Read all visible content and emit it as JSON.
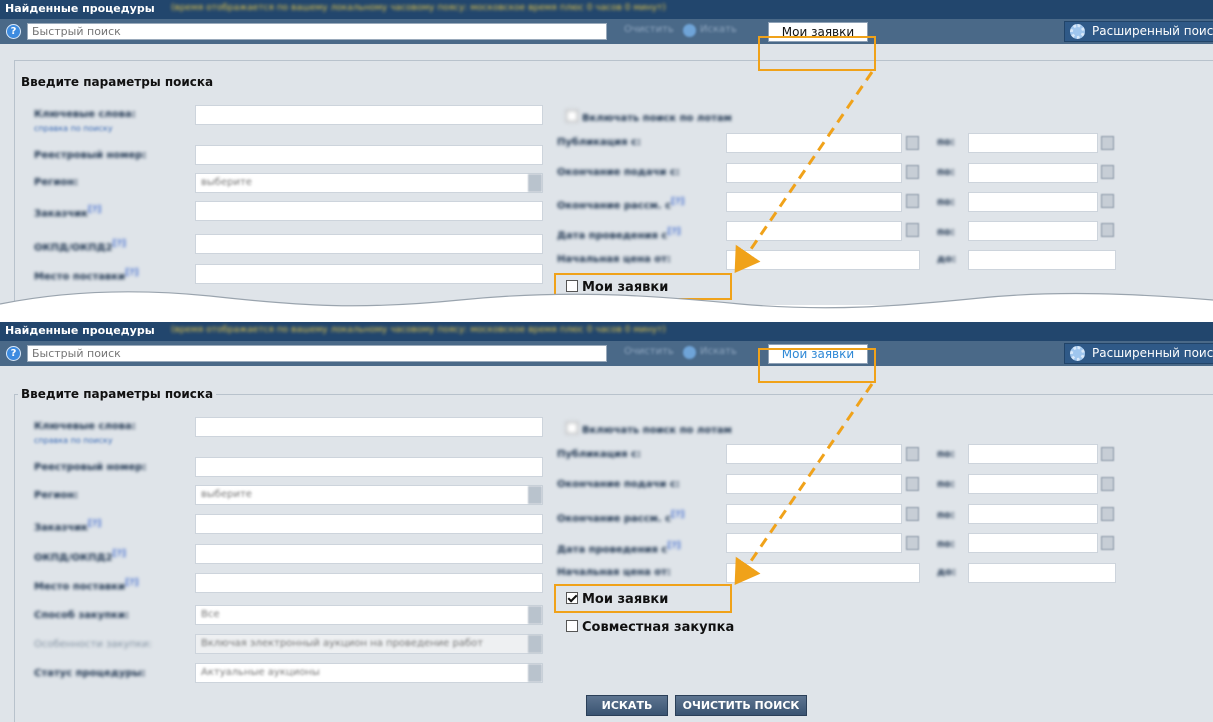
{
  "title": "Найденные процедуры",
  "title_note": "(время отображается по вашему локальному часовому поясу: московское время плюс 0 часов 0 минут)",
  "search": {
    "placeholder": "Быстрый поиск",
    "clear_label": "Очистить",
    "find_label": "Искать",
    "my_requests_label": "Мои заявки",
    "advanced_label": "Расширенный поиск"
  },
  "form": {
    "legend": "Введите параметры поиска",
    "left_labels": [
      "Ключевые слова:",
      "Реестровый номер:",
      "Регион:",
      "Заказчик",
      "ОКПД/ОКПД2",
      "Место поставки",
      "Способ закупки:",
      "Особенности закупки:",
      "Статус процедуры:"
    ],
    "keywords_help": "справка по поиску",
    "region_placeholder": "выберите",
    "method_value": "Все",
    "features_value": "Включая электронный аукцион на проведение работ",
    "status_value": "Актуальные аукционы",
    "lot_search_label": "Включать поиск по лотам",
    "right_labels": [
      "Публикация с:",
      "Окончание подачи с:",
      "Окончание рассм. с",
      "Дата проведения с",
      "Начальная цена от:"
    ],
    "to_label": "по:",
    "to_price_label": "до:",
    "my_requests_checkbox": "Мои заявки",
    "joint_purchase_checkbox": "Совместная закупка",
    "search_button": "ИСКАТЬ",
    "clear_search_button": "ОЧИСТИТЬ ПОИСК"
  },
  "panels": [
    {
      "name": "before",
      "my_requests_checked": false
    },
    {
      "name": "after",
      "my_requests_checked": true
    }
  ],
  "colors": {
    "highlight": "#f0a21a",
    "titlebar": "#22466d",
    "searchbar": "#4a6988",
    "background": "#dfe4e9"
  }
}
